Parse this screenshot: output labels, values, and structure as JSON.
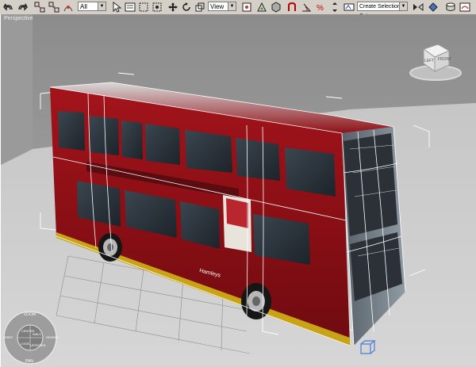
{
  "toolbar": {
    "selection_filter": "All",
    "reference_coord": "View",
    "named_selection_placeholder": "Create Selection Set"
  },
  "viewport": {
    "label": "Perspective",
    "viewcube_labels": [
      "LEFT",
      "FRONT"
    ],
    "steering_wheel": {
      "center": "CENTER",
      "top": "ZOOM",
      "bottom": "PAN",
      "left": "ORBIT",
      "right": "REWIND",
      "walk": "WALK",
      "look": "LOOK",
      "up_down": "UP/DOWN"
    },
    "colors": {
      "background_top": "#8e8e8e",
      "background_bottom": "#b5b5b5",
      "floor": "#cbcbcb",
      "bus_red": "#8f0f15",
      "gizmo": "#4b7bd6"
    }
  },
  "bus_ad_text": "Hamleys"
}
